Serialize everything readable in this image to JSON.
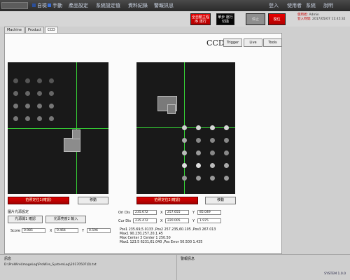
{
  "menubar": {
    "items": [
      {
        "label": "自檢",
        "active": false
      },
      {
        "label": "手動",
        "active": true
      },
      {
        "label": "產品設定",
        "active": false
      },
      {
        "label": "系統設定值",
        "active": false
      },
      {
        "label": "資料紀錄",
        "active": false
      },
      {
        "label": "警報訊息",
        "active": false
      }
    ],
    "login": "登入",
    "user_menu": "使用者",
    "sys_menu": "系統",
    "help_menu": "說明"
  },
  "toolbar": {
    "btn_red_1": "全自動主程序 運行",
    "btn_black": "單步 運行切換",
    "btn_gray": "停止",
    "btn_red_2": "復位",
    "info_user_key": "使用者:",
    "info_user_val": "Admin",
    "info_date_key": "登入時間:",
    "info_date_val": "2017/05/07 11:45:32"
  },
  "tabs": [
    "Machine",
    "Product",
    "CCD"
  ],
  "ccd": {
    "title": "CCD",
    "modes": [
      "Trigger",
      "Live",
      "Tools"
    ]
  },
  "left_cam": {
    "capture_btn": "拍照定位1(確認)",
    "move_btn": "移動",
    "settings_title": "圖片光源設定",
    "light_btn_1": "光源開1 確認",
    "light_btn_2": "光源亮度2 輸入",
    "score_label": "Score",
    "score_val": "0.985",
    "x_label": "X",
    "x_val": "0.464",
    "y_label": "Y",
    "y_val": "0.596"
  },
  "right_cam": {
    "capture_btn": "拍照定位2(確認)",
    "move_btn": "移動",
    "row1_label": "Ori Dis",
    "row1_val": "235.672",
    "row1_x_label": "X",
    "row1_x_val": "257.655",
    "row1_y_label": "Y",
    "row1_y_val": "85.049",
    "row2_label": "Cur Dis",
    "row2_val": "235.472",
    "row2_x_label": "X",
    "row2_x_val": "220.005",
    "row2_y_label": "Y",
    "row2_y_val": "1.975"
  },
  "results": {
    "lines": [
      "Pos1 235.69,5.0133 ,Pos2 257.235,60.105 ,Pos3 267.013",
      "Max1 90.230,257.20,1.45",
      "Max Center 3 Center 1 250.50",
      "Max1 123.5 6231,61.040 ,Pos Error 50.500 1.435"
    ]
  },
  "status": {
    "left_title": "訊息",
    "log_path": "D:\\ProWire\\ImageLog\\ProWire_SystemLog\\20170507(0).txt",
    "right_title": "警報訊息",
    "version": "SYSTEM 1.0.0"
  },
  "colors": {
    "accent_red": "#cc0000",
    "crosshair": "#35d035",
    "menubar": "#2a2a2a"
  }
}
